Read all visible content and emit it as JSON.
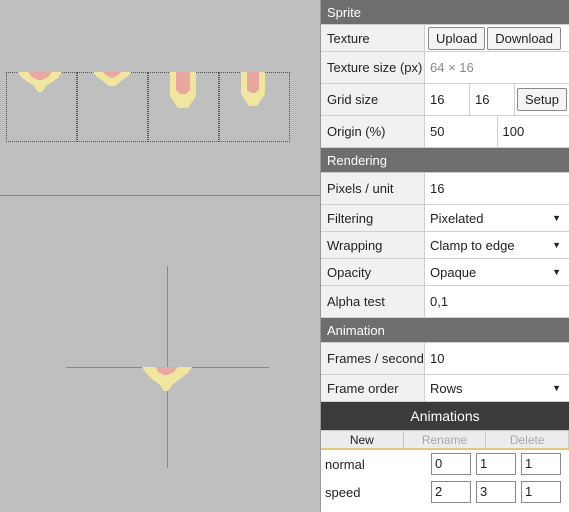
{
  "sprite": {
    "header": "Sprite",
    "texture_label": "Texture",
    "upload_label": "Upload",
    "download_label": "Download",
    "texture_size_label": "Texture size (px)",
    "texture_size_value": "64 × 16",
    "grid_size_label": "Grid size",
    "grid_w": "16",
    "grid_h": "16",
    "setup_label": "Setup",
    "origin_label": "Origin (%)",
    "origin_x": "50",
    "origin_y": "100"
  },
  "rendering": {
    "header": "Rendering",
    "pixels_per_unit_label": "Pixels / unit",
    "pixels_per_unit_value": "16",
    "filtering_label": "Filtering",
    "filtering_value": "Pixelated",
    "wrapping_label": "Wrapping",
    "wrapping_value": "Clamp to edge",
    "opacity_label": "Opacity",
    "opacity_value": "Opaque",
    "alpha_test_label": "Alpha test",
    "alpha_test_value": "0,1"
  },
  "animation": {
    "header": "Animation",
    "fps_label": "Frames / second",
    "fps_value": "10",
    "frame_order_label": "Frame order",
    "frame_order_value": "Rows"
  },
  "animations": {
    "title": "Animations",
    "new_label": "New",
    "rename_label": "Rename",
    "delete_label": "Delete",
    "items": [
      {
        "name": "normal",
        "start": "0",
        "end": "1",
        "speed": "1"
      },
      {
        "name": "speed",
        "start": "2",
        "end": "3",
        "speed": "1"
      }
    ]
  },
  "colors": {
    "sprite_body": "#f0e6a0",
    "sprite_core": "#e8a8a0"
  }
}
